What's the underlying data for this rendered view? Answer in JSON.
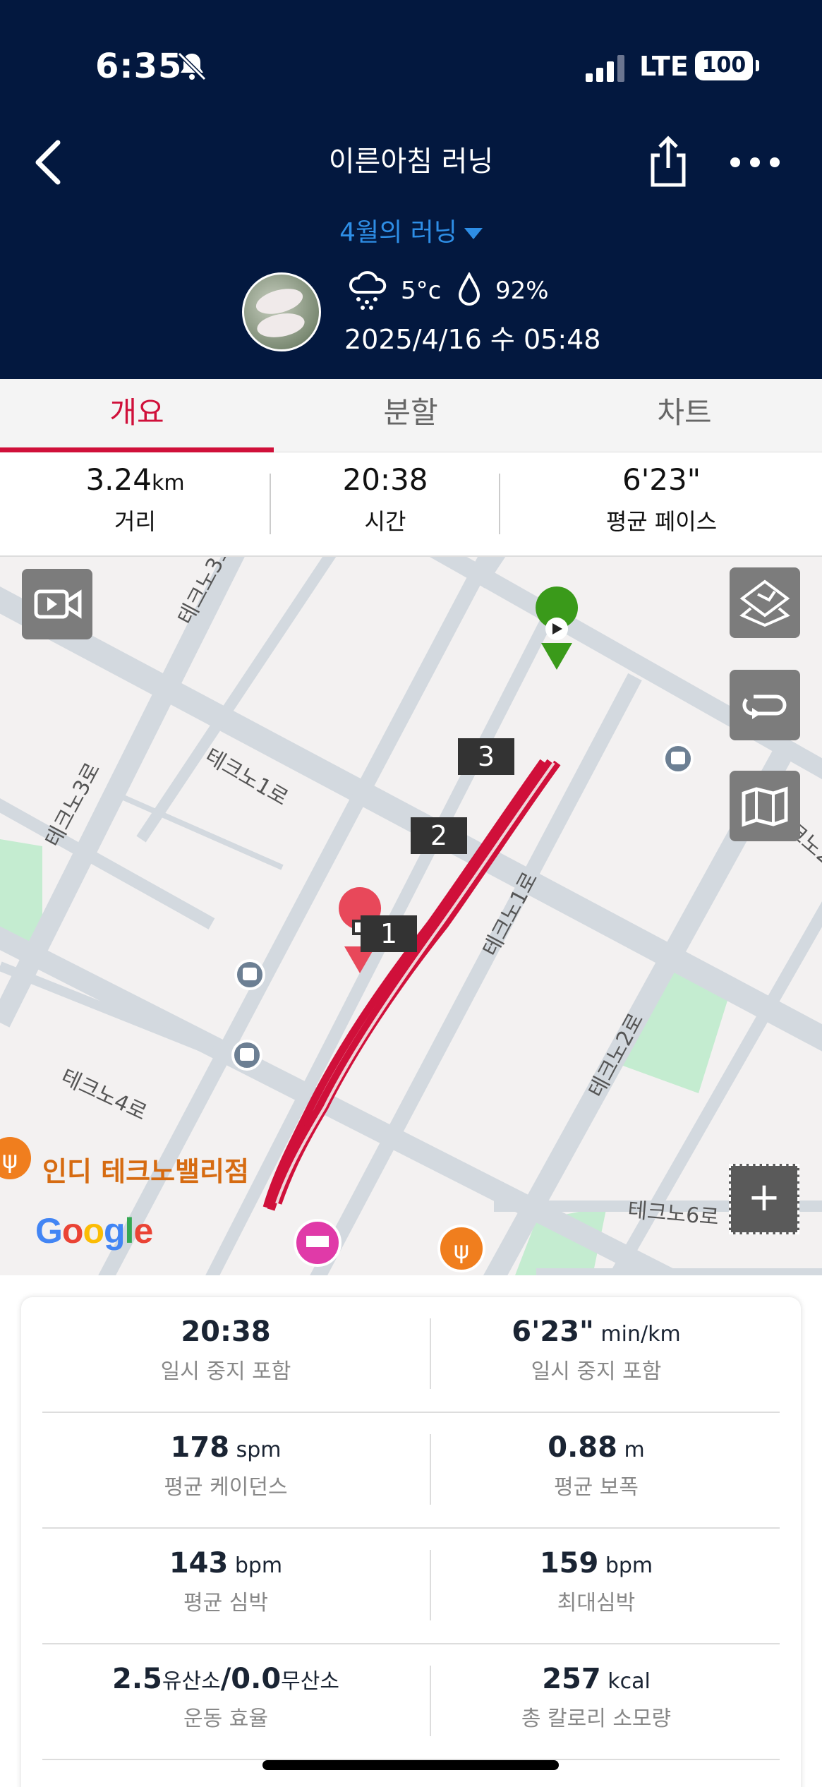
{
  "status_bar": {
    "time": "6:35",
    "network": "LTE",
    "battery": "100"
  },
  "header": {
    "title": "이른아침 러닝",
    "month_selector": "4월의 러닝",
    "temperature": "5°c",
    "humidity": "92%",
    "datetime": "2025/4/16 수 05:48"
  },
  "tabs": [
    {
      "label": "개요",
      "active": true
    },
    {
      "label": "분할",
      "active": false
    },
    {
      "label": "차트",
      "active": false
    }
  ],
  "summary": {
    "distance": {
      "value": "3.24",
      "unit": "km",
      "label": "거리"
    },
    "time": {
      "value": "20:38",
      "label": "시간"
    },
    "pace": {
      "value": "6'23\"",
      "label": "평균 페이스"
    }
  },
  "map": {
    "poi_label": "인디 테크노밸리점",
    "streets": [
      "테크노3로",
      "테크노1로",
      "테크노3로",
      "테크노1로",
      "테크노2로",
      "테크노2로",
      "테크노4로",
      "테크노6로"
    ],
    "km_markers": [
      "1",
      "2",
      "3"
    ],
    "google": [
      "G",
      "o",
      "o",
      "g",
      "l",
      "e"
    ],
    "zoom_label": "+",
    "route_color": "#d0103a",
    "start_color": "#3a9a1a",
    "end_color": "#e8485a"
  },
  "stats": [
    {
      "left": {
        "value": "20:38",
        "unit": "",
        "label": "일시 중지 포함"
      },
      "right": {
        "value": "6'23\"",
        "unit": " min/km",
        "label": "일시 중지 포함"
      }
    },
    {
      "left": {
        "value": "178",
        "unit": " spm",
        "label": "평균 케이던스"
      },
      "right": {
        "value": "0.88",
        "unit": " m",
        "label": "평균 보폭"
      }
    },
    {
      "left": {
        "value": "143",
        "unit": " bpm",
        "label": "평균 심박"
      },
      "right": {
        "value": "159",
        "unit": " bpm",
        "label": "최대심박"
      }
    },
    {
      "left": {
        "value": "2.5",
        "unit": "유산소",
        "value2": "/0.0",
        "unit2": "무산소",
        "label": "운동 효율"
      },
      "right": {
        "value": "257",
        "unit": " kcal",
        "label": "총 칼로리 소모량"
      }
    }
  ]
}
